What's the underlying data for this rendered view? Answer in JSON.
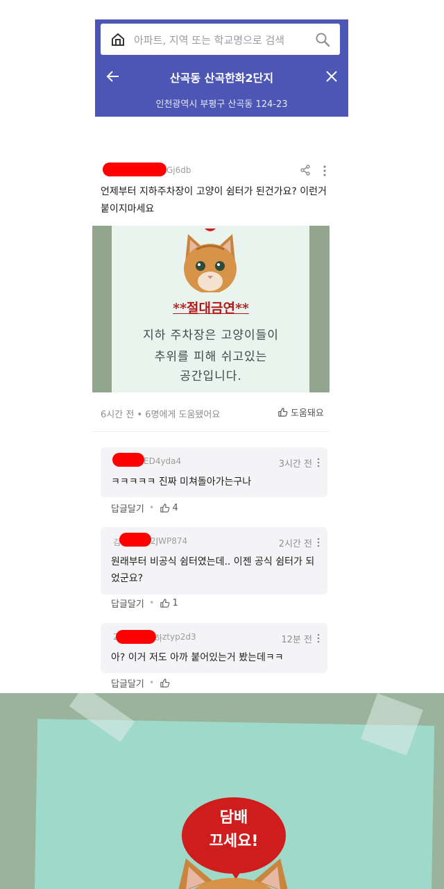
{
  "header": {
    "search_placeholder": "아파트, 지역 또는 학교명으로 검색",
    "title": "산곡동 산곡한화2단지",
    "address": "인천광역시 부평구 산곡동 124-23",
    "bg_color": "#4c57b5"
  },
  "post": {
    "user_suffix": "Gj6db",
    "text": "언제부터 지하주차장이 고양이 쉼터가 된건가요? 이런거 붙이지마세요",
    "photo_notice": {
      "title": "**절대금연**",
      "line1": "지하 주차장은 고양이들이",
      "line2": "추위를 피해 쉬고있는",
      "line3": "공간입니다."
    },
    "meta": "6시간 전 • 6명에게 도움됐어요",
    "helpful_label": "도움돼요"
  },
  "comments": [
    {
      "user": "ED4yda4",
      "time": "3시간 전",
      "text": "ㅋㅋㅋㅋㅋ 진짜 미쳐돌아가는구나",
      "reply_label": "답글달기",
      "likes": "4"
    },
    {
      "user_prefix": "김",
      "user": "2JWP874",
      "time": "2시간 전",
      "text": "원래부터 비공식 쉼터였는데.. 이젠 공식 쉼터가 되었군요?",
      "reply_label": "답글달기",
      "likes": "1"
    },
    {
      "user_prefix": "2",
      "user": "ztyp2d3",
      "user_mid": "하",
      "time": "12분 전",
      "text": "아? 이거 저도 아까 붙어있는거 봤는데ㅋㅋ",
      "reply_label": "답글달기",
      "likes": ""
    }
  ],
  "bottom_photo": {
    "bubble_line1": "담배",
    "bubble_line2": "끄세요!"
  },
  "redaction_color": "#ff0000"
}
